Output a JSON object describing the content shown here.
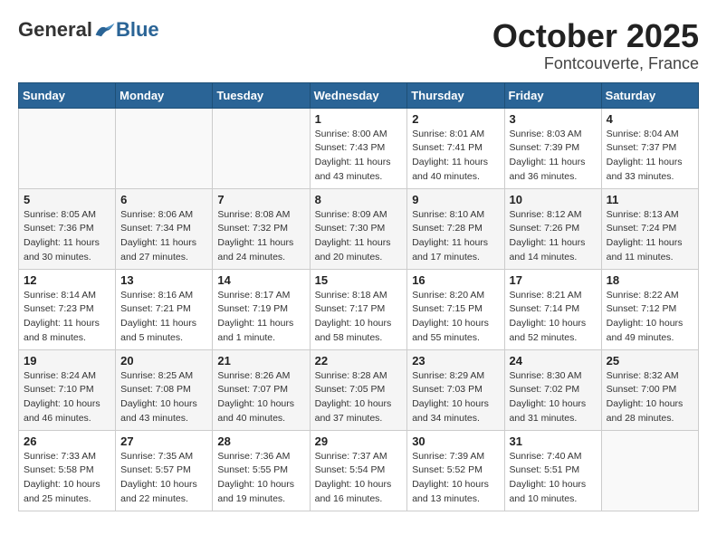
{
  "header": {
    "logo_general": "General",
    "logo_blue": "Blue",
    "month": "October 2025",
    "location": "Fontcouverte, France"
  },
  "days_of_week": [
    "Sunday",
    "Monday",
    "Tuesday",
    "Wednesday",
    "Thursday",
    "Friday",
    "Saturday"
  ],
  "weeks": [
    [
      {
        "day": "",
        "info": ""
      },
      {
        "day": "",
        "info": ""
      },
      {
        "day": "",
        "info": ""
      },
      {
        "day": "1",
        "info": "Sunrise: 8:00 AM\nSunset: 7:43 PM\nDaylight: 11 hours\nand 43 minutes."
      },
      {
        "day": "2",
        "info": "Sunrise: 8:01 AM\nSunset: 7:41 PM\nDaylight: 11 hours\nand 40 minutes."
      },
      {
        "day": "3",
        "info": "Sunrise: 8:03 AM\nSunset: 7:39 PM\nDaylight: 11 hours\nand 36 minutes."
      },
      {
        "day": "4",
        "info": "Sunrise: 8:04 AM\nSunset: 7:37 PM\nDaylight: 11 hours\nand 33 minutes."
      }
    ],
    [
      {
        "day": "5",
        "info": "Sunrise: 8:05 AM\nSunset: 7:36 PM\nDaylight: 11 hours\nand 30 minutes."
      },
      {
        "day": "6",
        "info": "Sunrise: 8:06 AM\nSunset: 7:34 PM\nDaylight: 11 hours\nand 27 minutes."
      },
      {
        "day": "7",
        "info": "Sunrise: 8:08 AM\nSunset: 7:32 PM\nDaylight: 11 hours\nand 24 minutes."
      },
      {
        "day": "8",
        "info": "Sunrise: 8:09 AM\nSunset: 7:30 PM\nDaylight: 11 hours\nand 20 minutes."
      },
      {
        "day": "9",
        "info": "Sunrise: 8:10 AM\nSunset: 7:28 PM\nDaylight: 11 hours\nand 17 minutes."
      },
      {
        "day": "10",
        "info": "Sunrise: 8:12 AM\nSunset: 7:26 PM\nDaylight: 11 hours\nand 14 minutes."
      },
      {
        "day": "11",
        "info": "Sunrise: 8:13 AM\nSunset: 7:24 PM\nDaylight: 11 hours\nand 11 minutes."
      }
    ],
    [
      {
        "day": "12",
        "info": "Sunrise: 8:14 AM\nSunset: 7:23 PM\nDaylight: 11 hours\nand 8 minutes."
      },
      {
        "day": "13",
        "info": "Sunrise: 8:16 AM\nSunset: 7:21 PM\nDaylight: 11 hours\nand 5 minutes."
      },
      {
        "day": "14",
        "info": "Sunrise: 8:17 AM\nSunset: 7:19 PM\nDaylight: 11 hours\nand 1 minute."
      },
      {
        "day": "15",
        "info": "Sunrise: 8:18 AM\nSunset: 7:17 PM\nDaylight: 10 hours\nand 58 minutes."
      },
      {
        "day": "16",
        "info": "Sunrise: 8:20 AM\nSunset: 7:15 PM\nDaylight: 10 hours\nand 55 minutes."
      },
      {
        "day": "17",
        "info": "Sunrise: 8:21 AM\nSunset: 7:14 PM\nDaylight: 10 hours\nand 52 minutes."
      },
      {
        "day": "18",
        "info": "Sunrise: 8:22 AM\nSunset: 7:12 PM\nDaylight: 10 hours\nand 49 minutes."
      }
    ],
    [
      {
        "day": "19",
        "info": "Sunrise: 8:24 AM\nSunset: 7:10 PM\nDaylight: 10 hours\nand 46 minutes."
      },
      {
        "day": "20",
        "info": "Sunrise: 8:25 AM\nSunset: 7:08 PM\nDaylight: 10 hours\nand 43 minutes."
      },
      {
        "day": "21",
        "info": "Sunrise: 8:26 AM\nSunset: 7:07 PM\nDaylight: 10 hours\nand 40 minutes."
      },
      {
        "day": "22",
        "info": "Sunrise: 8:28 AM\nSunset: 7:05 PM\nDaylight: 10 hours\nand 37 minutes."
      },
      {
        "day": "23",
        "info": "Sunrise: 8:29 AM\nSunset: 7:03 PM\nDaylight: 10 hours\nand 34 minutes."
      },
      {
        "day": "24",
        "info": "Sunrise: 8:30 AM\nSunset: 7:02 PM\nDaylight: 10 hours\nand 31 minutes."
      },
      {
        "day": "25",
        "info": "Sunrise: 8:32 AM\nSunset: 7:00 PM\nDaylight: 10 hours\nand 28 minutes."
      }
    ],
    [
      {
        "day": "26",
        "info": "Sunrise: 7:33 AM\nSunset: 5:58 PM\nDaylight: 10 hours\nand 25 minutes."
      },
      {
        "day": "27",
        "info": "Sunrise: 7:35 AM\nSunset: 5:57 PM\nDaylight: 10 hours\nand 22 minutes."
      },
      {
        "day": "28",
        "info": "Sunrise: 7:36 AM\nSunset: 5:55 PM\nDaylight: 10 hours\nand 19 minutes."
      },
      {
        "day": "29",
        "info": "Sunrise: 7:37 AM\nSunset: 5:54 PM\nDaylight: 10 hours\nand 16 minutes."
      },
      {
        "day": "30",
        "info": "Sunrise: 7:39 AM\nSunset: 5:52 PM\nDaylight: 10 hours\nand 13 minutes."
      },
      {
        "day": "31",
        "info": "Sunrise: 7:40 AM\nSunset: 5:51 PM\nDaylight: 10 hours\nand 10 minutes."
      },
      {
        "day": "",
        "info": ""
      }
    ]
  ]
}
